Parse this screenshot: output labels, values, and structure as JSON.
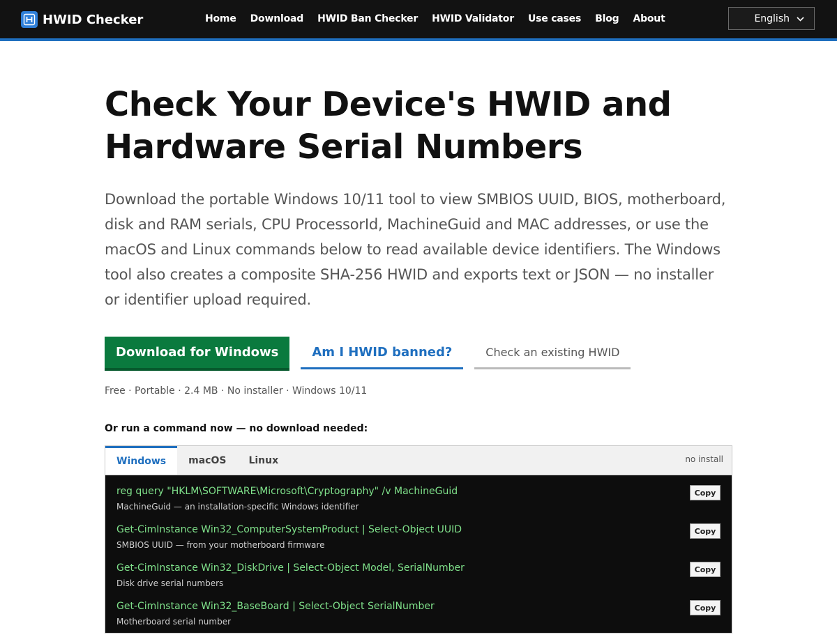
{
  "header": {
    "brand": "HWID Checker",
    "logo_icon": "hwid-logo-icon",
    "nav": [
      {
        "label": "Home"
      },
      {
        "label": "Download"
      },
      {
        "label": "HWID Ban Checker"
      },
      {
        "label": "HWID Validator"
      },
      {
        "label": "Use cases"
      },
      {
        "label": "Blog"
      },
      {
        "label": "About"
      }
    ],
    "language": "English",
    "colors": {
      "bar": "#121212",
      "accent": "#1f6fbf"
    }
  },
  "hero": {
    "title": "Check Your Device's HWID and Hardware Serial Numbers",
    "lede": "Download the portable Windows 10/11 tool to view SMBIOS UUID, BIOS, motherboard, disk and RAM serials, CPU ProcessorId, MachineGuid and MAC addresses, or use the macOS and Linux commands below to read available device identifiers. The Windows tool also creates a composite SHA-256 HWID and exports text or JSON — no installer or identifier upload required.",
    "buttons": {
      "download": "Download for Windows",
      "banned": "Am I HWID banned?",
      "check": "Check an existing HWID"
    },
    "meta": "Free · Portable · 2.4 MB · No installer · Windows 10/11",
    "run_now": "Or run a command now — no download needed:"
  },
  "panel": {
    "tabs": [
      {
        "label": "Windows",
        "active": true
      },
      {
        "label": "macOS",
        "active": false
      },
      {
        "label": "Linux",
        "active": false
      }
    ],
    "note": "no install",
    "copy_label": "Copy",
    "commands": [
      {
        "cmd": "reg query \"HKLM\\SOFTWARE\\Microsoft\\Cryptography\" /v MachineGuid",
        "desc": "MachineGuid — an installation-specific Windows identifier"
      },
      {
        "cmd": "Get-CimInstance Win32_ComputerSystemProduct | Select-Object UUID",
        "desc": "SMBIOS UUID — from your motherboard firmware"
      },
      {
        "cmd": "Get-CimInstance Win32_DiskDrive | Select-Object Model, SerialNumber",
        "desc": "Disk drive serial numbers"
      },
      {
        "cmd": "Get-CimInstance Win32_BaseBoard | Select-Object SerialNumber",
        "desc": "Motherboard serial number"
      }
    ],
    "colors": {
      "command": "#7fe08a",
      "background": "#0d0d0d"
    }
  }
}
